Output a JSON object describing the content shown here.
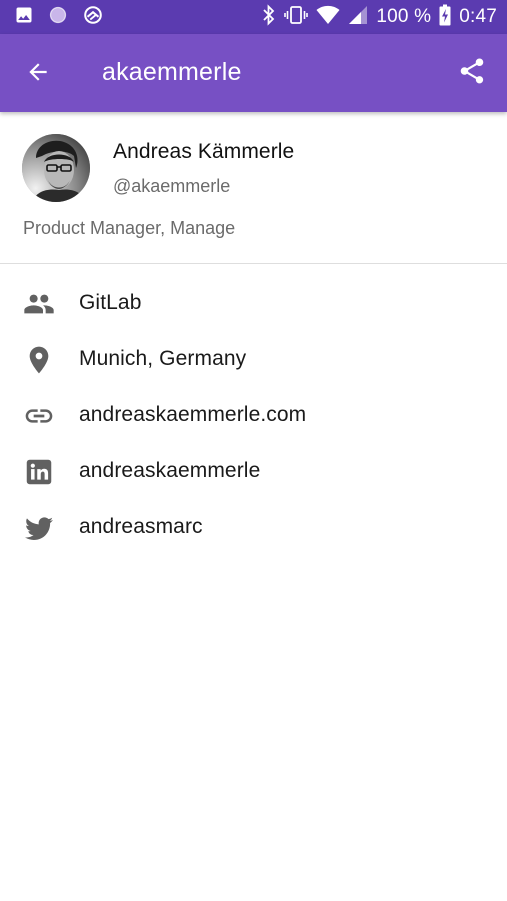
{
  "status_bar": {
    "battery": "100 %",
    "time": "0:47",
    "icons": [
      "image-icon",
      "circle-notification-icon",
      "sync-app-icon",
      "bluetooth-icon",
      "vibrate-icon",
      "wifi-icon",
      "signal-icon",
      "battery-charging-icon"
    ]
  },
  "app_bar": {
    "title": "akaemmerle",
    "back_icon": "arrow-back-icon",
    "share_icon": "share-icon",
    "color": "#7750c4"
  },
  "profile": {
    "name": "Andreas Kämmerle",
    "handle": "@akaemmerle",
    "bio": "Product Manager, Manage"
  },
  "info": [
    {
      "icon": "people-icon",
      "text": "GitLab"
    },
    {
      "icon": "location-pin-icon",
      "text": "Munich, Germany"
    },
    {
      "icon": "link-icon",
      "text": "andreaskaemmerle.com"
    },
    {
      "icon": "linkedin-icon",
      "text": "andreaskaemmerle"
    },
    {
      "icon": "twitter-icon",
      "text": "andreasmarc"
    }
  ]
}
